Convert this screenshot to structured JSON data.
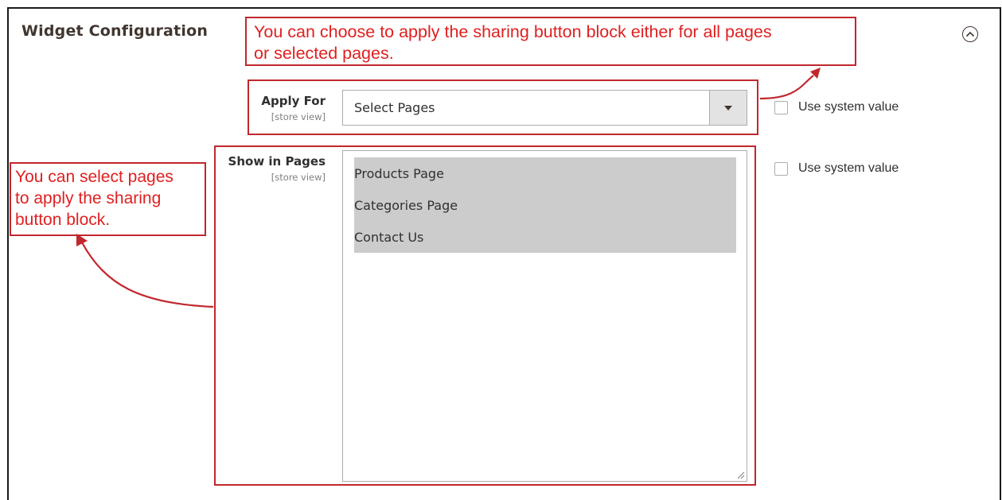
{
  "section": {
    "title": "Widget Configuration",
    "collapse_icon": "chevron-up-circle-icon"
  },
  "callouts": {
    "top_line1": "You can choose to apply the sharing button block either for all pages",
    "top_line2": "or selected pages.",
    "left_line1": "You can select pages",
    "left_line2": "to apply the sharing",
    "left_line3": "button block."
  },
  "apply_for": {
    "label": "Apply For",
    "scope": "[store view]",
    "selected_value": "Select Pages",
    "use_system_value_label": "Use system value",
    "use_system_value_checked": false
  },
  "show_in_pages": {
    "label": "Show in Pages",
    "scope": "[store view]",
    "options": [
      "Products Page",
      "Categories Page",
      "Contact Us"
    ],
    "selected": [
      "Products Page",
      "Categories Page",
      "Contact Us"
    ],
    "use_system_value_label": "Use system value",
    "use_system_value_checked": false
  },
  "colors": {
    "annotation": "#c1272d",
    "annotation_text": "#e02020",
    "selected_option_bg": "#cccccc"
  }
}
